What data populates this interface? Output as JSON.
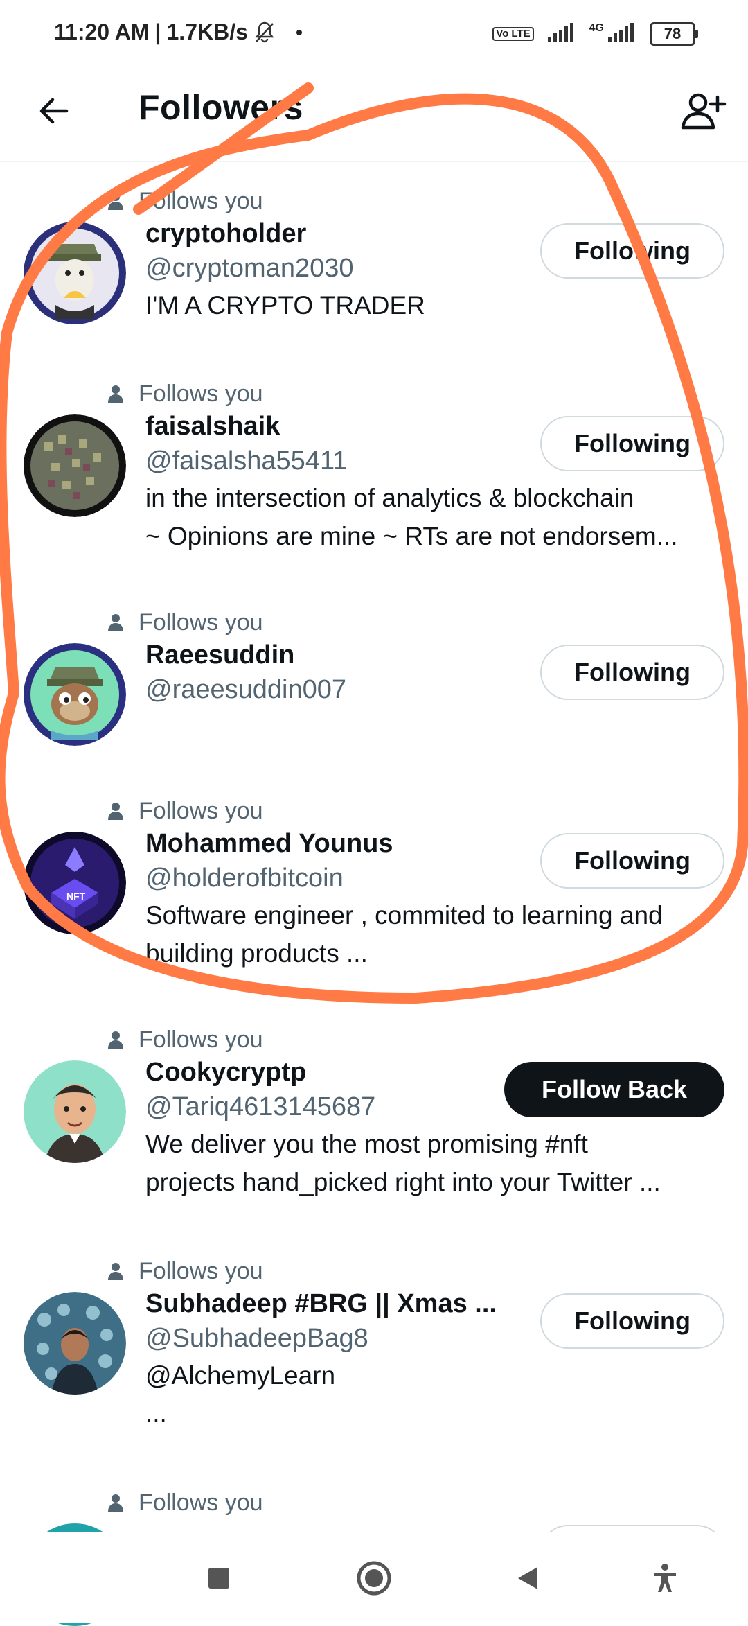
{
  "status_bar": {
    "time": "11:20 AM",
    "speed": "1.7KB/s",
    "volte": "Vo LTE",
    "network": "4G",
    "battery": "78"
  },
  "header": {
    "title": "Followers",
    "back_icon": "arrow-left-icon",
    "add_icon": "add-user-icon"
  },
  "follows_you_label": "Follows you",
  "followers": [
    {
      "name": "cryptoholder",
      "handle": "@cryptoman2030",
      "bio": [
        "I'M A CRYPTO TRADER"
      ],
      "button": "Following"
    },
    {
      "name": "faisalshaik",
      "handle": "@faisalsha55411",
      "bio": [
        "in the intersection of analytics & blockchain",
        "~ Opinions are mine ~ RTs are not endorsem..."
      ],
      "button": "Following"
    },
    {
      "name": "Raeesuddin",
      "handle": "@raeesuddin007",
      "bio": [],
      "button": "Following"
    },
    {
      "name": "Mohammed Younus",
      "handle": "@holderofbitcoin",
      "bio": [
        "Software engineer , commited to learning and",
        "building products ..."
      ],
      "button": "Following"
    },
    {
      "name": "Cookycryptp",
      "handle": "@Tariq4613145687",
      "bio": [
        "We deliver you the most promising #nft",
        "projects hand_picked right into your Twitter ..."
      ],
      "button": "Follow Back"
    },
    {
      "name": "Subhadeep #BRG || Xmas ...",
      "handle": "@SubhadeepBag8",
      "bio": [
        "@AlchemyLearn",
        "..."
      ],
      "button": "Following"
    }
  ],
  "nav": {
    "items": [
      "recents-icon",
      "home-icon",
      "back-icon",
      "accessibility-icon"
    ]
  },
  "colors": {
    "annotation": "#ff7a45",
    "secondary_text": "#536471",
    "button_border": "#cfd9de",
    "follow_back_bg": "#0f1419"
  }
}
